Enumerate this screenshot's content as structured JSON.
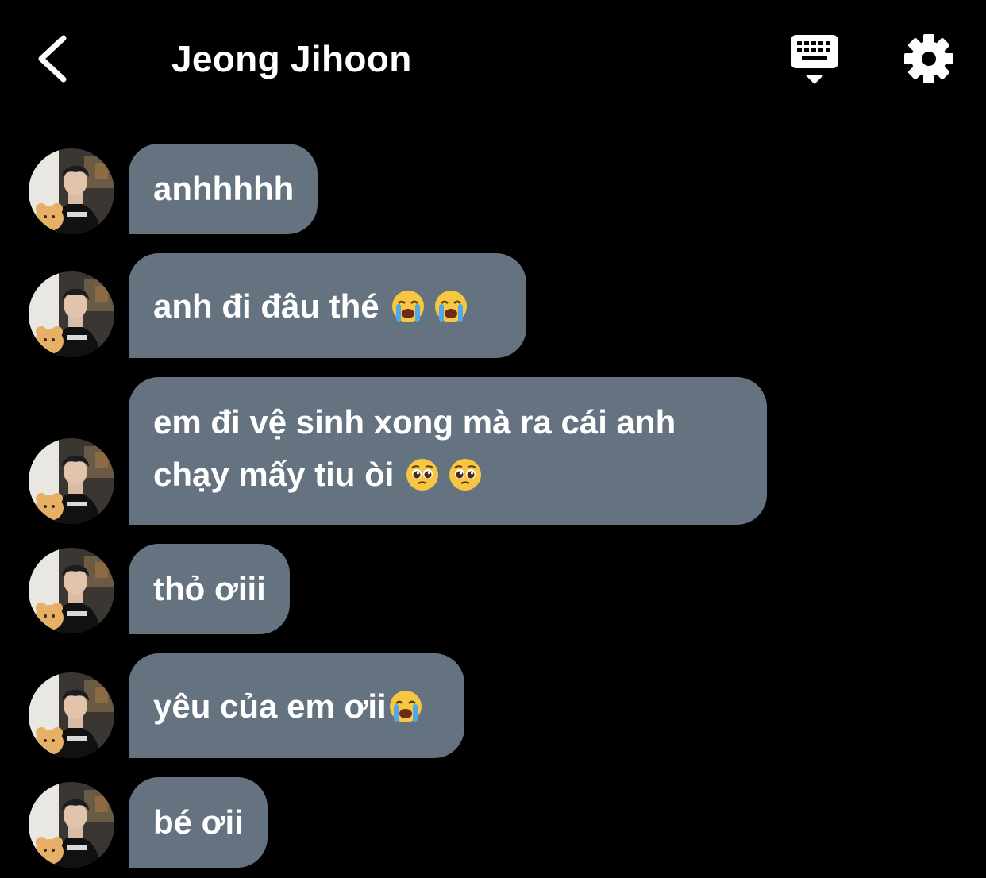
{
  "header": {
    "title": "Jeong Jihoon",
    "back_icon": "chevron-left-icon",
    "keyboard_icon": "keyboard-icon",
    "settings_icon": "gear-icon"
  },
  "colors": {
    "background": "#000000",
    "bubble": "#657380",
    "text": "#ffffff"
  },
  "messages": [
    {
      "text": "anhhhhh",
      "emojis": []
    },
    {
      "text": "anh đi đâu thé",
      "emojis": [
        "loudly-crying-face",
        "loudly-crying-face"
      ]
    },
    {
      "line1": "em đi vệ sinh xong mà ra cái anh",
      "line2": "chạy mấy tiu òi",
      "emojis": [
        "pleading-face",
        "pleading-face"
      ]
    },
    {
      "text": "thỏ ơiii",
      "emojis": []
    },
    {
      "text": "yêu của em ơii",
      "emojis": [
        "loudly-crying-face"
      ]
    },
    {
      "text": "bé ơii",
      "emojis": []
    }
  ]
}
